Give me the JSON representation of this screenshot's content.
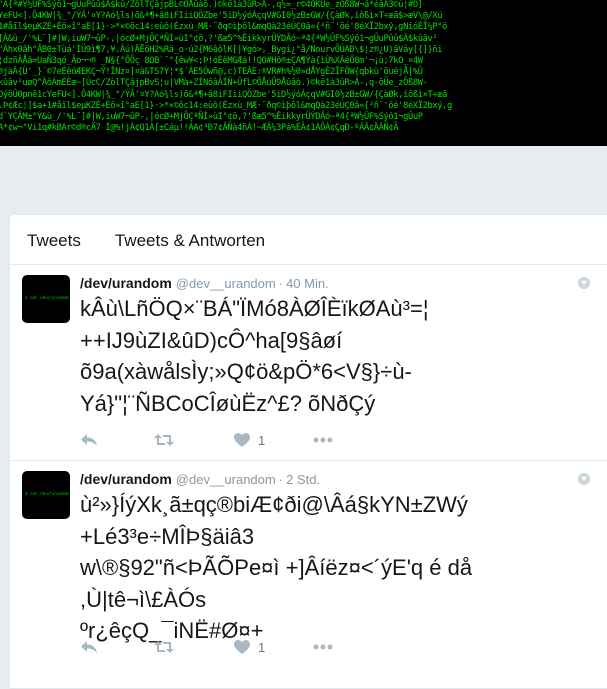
{
  "header": {
    "banner_lines": [
      "\"Â{ª#Ý½ÛF%Sýô1¬gÛuPûû$Â$kû/ZôlTÇâjpBL©ÒÅûàõ.)©kë1à3ûR>Â-,q½=_r©4ÕKÜe_zÕß8W¬â*éâÂ3©ú¦#O]",
      "YeFU<].Ô4KW|¾_°/ÝÂ'¤Y?Aó¾ls)õ&ª¶+â8iFIiiQÖZbe'5iD½ýóÁçqV#GI0½zB±GW/{ÇàØk,íôßì×T÷æã$>æV\\@/Xú",
      "1#åïl$eµKZÉ+Èõ»î°aE[1}·>*×©õc14:eùô(Ézxù_MÆ·¨ðq©ìþôl&mqQà23éÙÇ0â«{²ñ¨'õé'8éXÏ2bxý,gNióÉÎ¼P°ö",
      "[Â&ù_/'%L¨]#|W,iuW7¬ûP-,|ócØ+MjÕÇªÑÌ»ùI°¢ö,?'ßæ5^%ÊikkyrÜÝDÂó~ª4{ªW½ÛF%Sýô1¬gÛuPûû$Â$kûâv²",
      "\"Âhx0âh°ÂB0±Tùá'ÍÜ9ì¶7,¥.Âú)ÄËöH2%Rä_o·ú2{M6âôlK[|¥gó>,_Bygi¿°å/NourvÕÚAÐ\\$¦z®¿U)âVây[{]}ñi",
      "¦dzñÂÅâ=UaÑ3qó_Ão¬¬® _N§{°ÔÔç 8OB`¨°{êw¥<;Þ!óÉêMGÆá!!QO#Hô®±ÇA¶Ýà{ìÙ%XÂéÖ8m'¬¡ù;7kO_¤4W",
      "®jàÂ{Ù'_}´©7eÉêóÆEKÇ¬Ý!ÎNz¤]¤à&TS7Ý¦*$´ÁE5Öwñ@,c)TEÂÈ:®VR#h%½0»dÅYgÈ2ÎFÖW{qbkù'õuéjÅ|%Û",
      "kûâv²uøQ^ÂôÁmÉÈæ~[ÙcC/ZòlTÇâjpBvS¦u|VMà+ZÍNôâÂÍÑ+ÛfL©ÕÅúÛ9Åûâò.)©kë1à3ûR>Â-,q-ôÜe_zÕß8W-",
      "OýöÛ0pnê1cYeFU<].Ô4KW|¾_°/ÝÂ'¤Y?Aó¾ls)õ&ª¶+â8iFIiiQÖZbe'5iD½ýóÁçqV#GI0½zB±GW/{ÇàØk,íôßì×T÷æã",
      ".Þ¢Æc¦]$a+1#åïl$eµKZÉ+Èõ»î°aE[1}·>*×©õc14:eùô(Ézxù_MÆ·¨ðq©ìþôl&mqQà23éÙÇ0â«{²ñ¨'õé'8éXÏ2bxý,g",
      "d`YÇÃM±°Ý&ù_/'%L¨]#|W,iuW7¬ûP-,|ócØ+MjÕÇªÑÌ»ùI°¢ö,?'ßæ5^%ÊikkyrÜÝDÂó~ª4{ªW½ÛF%Sýô1¬gÛuP",
      "A*¢w¬°Vi1q#kBAr©d®cÄ7 Ì@%!jÀ¢Q1À[±Cáµ!!ÁA¢³Ð7¢ÂÑà4ñÁ!~ÆÂ¼3Pá%ÉÂ¢1ÀÔÁ¢ÇqÐ-ºÂÂ¢ÄÂÑ¢Ã"
    ]
  },
  "tabs": [
    {
      "label": "Tweets"
    },
    {
      "label": "Tweets & Antworten"
    }
  ],
  "tweets": [
    {
      "name": "/dev/urandom",
      "handle": "@dev__urandom",
      "separator": "·",
      "time": "40 Min.",
      "text": "kÂù\\LñÖQ×¨BÁ\"ÏMó8ÀØÎÈïkØAù³=¦\n++IJ9ùZI&ûD)cÔ^ha[9§âøí\nõ9a(xàwålsÌy;»Q¢ö&pÖ*6<V§}÷ù-\nYá}\"¦¨ÑBCoCÎøùËz^£? õNðÇý",
      "reply_count": "",
      "retweet_count": "",
      "like_count": "1"
    },
    {
      "name": "/dev/urandom",
      "handle": "@dev__urandom",
      "separator": "·",
      "time": "2 Std.",
      "text": "ù²»}ÍýXk¸ã±qç®biÆ¢ði@\\Âá§kYN±ZWý\n+Lé3³e÷MÎÞ§äiâ3\nw\\®§92\"ñ<ÞÃÕPe¤ì +]Âíëz¤<´ýE'q é då\n,Ù|tê¬ì\\£ÀÓs\nºr¿êçQ_¯iNË#Ø¤+",
      "reply_count": "",
      "retweet_count": "",
      "like_count": "1"
    }
  ],
  "icons": {
    "reply": "reply-icon",
    "retweet": "retweet-icon",
    "like": "heart-icon",
    "more": "more-dots-icon",
    "caret": "chevron-down-icon"
  },
  "colors": {
    "banner_bg": "#000000",
    "banner_text": "#00e000",
    "page_bg": "#e6ecf0",
    "muted": "#aab8c2"
  }
}
